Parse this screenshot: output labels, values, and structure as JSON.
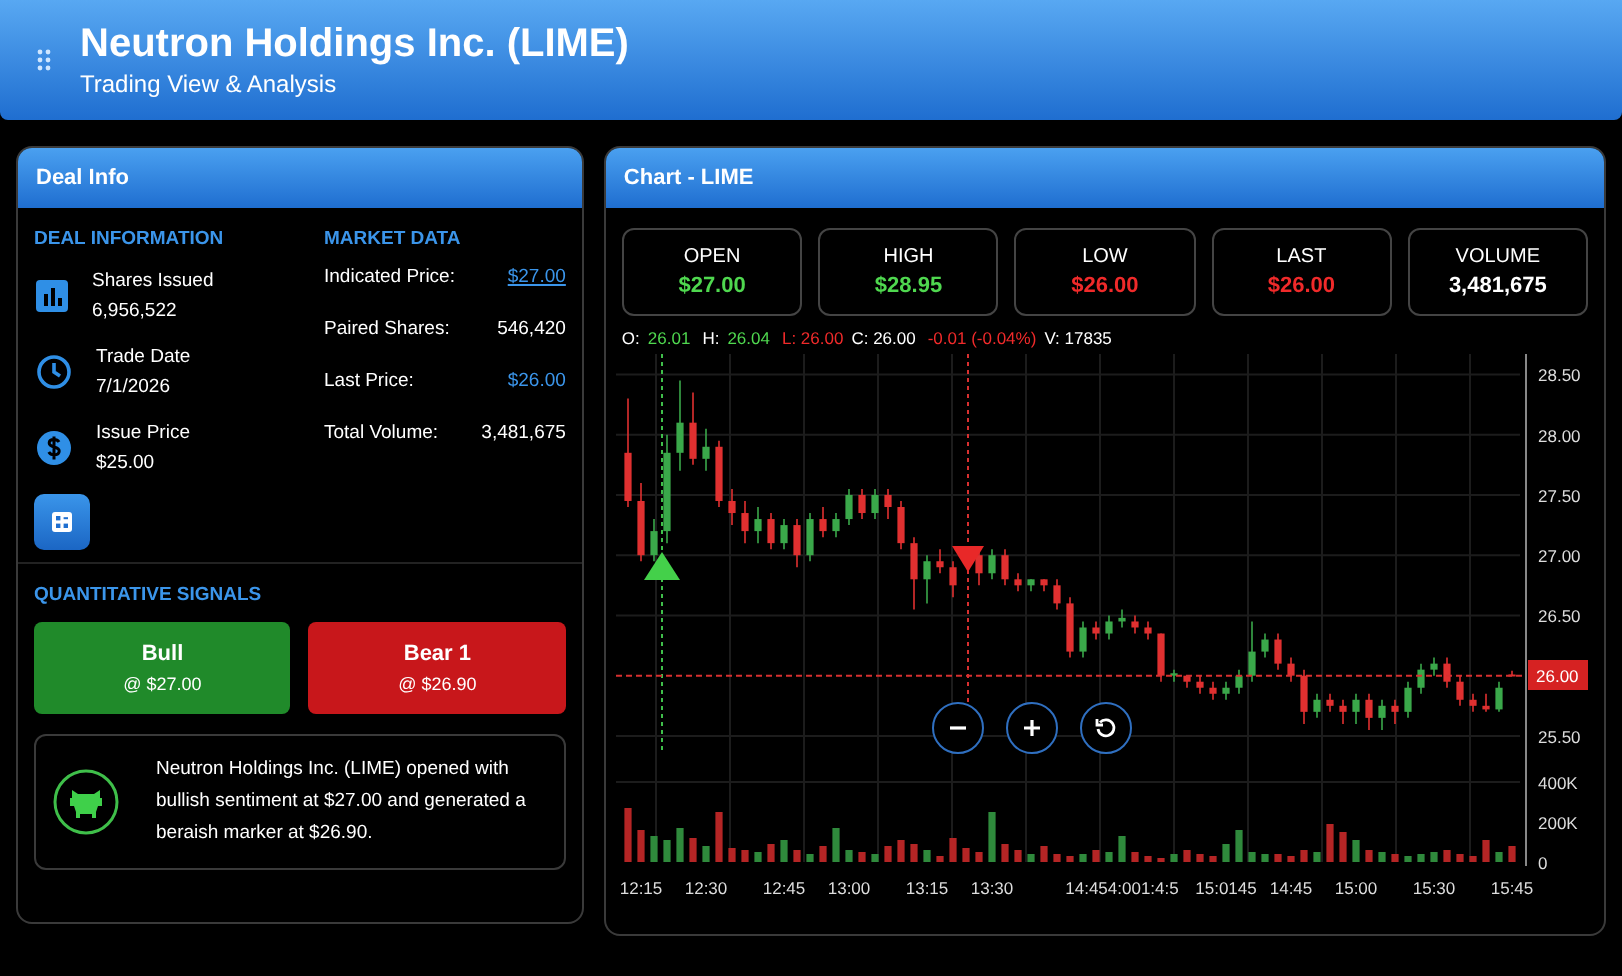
{
  "header": {
    "title": "Neutron Holdings Inc. (LIME)",
    "subtitle": "Trading View & Analysis"
  },
  "deal_panel": {
    "title": "Deal Info",
    "deal_heading": "DEAL INFORMATION",
    "deal_items": [
      {
        "kind": "chart",
        "label": "Shares Issued",
        "value": "6,956,522"
      },
      {
        "kind": "clock",
        "label": "Trade Date",
        "value": "7/1/2026"
      },
      {
        "kind": "dollar",
        "label": "Issue Price",
        "value": "$25.00"
      }
    ],
    "market_heading": "MARKET DATA",
    "market_items": [
      {
        "label": "Indicated Price:",
        "value": "$27.00",
        "kind": "link"
      },
      {
        "label": "Paired Shares:",
        "value": "546,420",
        "kind": "plain"
      },
      {
        "label": "Last Price:",
        "value": "$26.00",
        "kind": "accent"
      },
      {
        "label": "Total Volume:",
        "value": "3,481,675",
        "kind": "plain"
      }
    ],
    "signals_heading": "QUANTITATIVE SIGNALS",
    "signals": [
      {
        "kind": "bull",
        "label": "Bull",
        "price": "@ $27.00"
      },
      {
        "kind": "bear",
        "label": "Bear 1",
        "price": "@ $26.90"
      }
    ],
    "message": "Neutron Holdings Inc. (LIME) opened with bullish sentiment at $27.00 and generated a beraish marker at $26.90."
  },
  "chart_panel": {
    "title": "Chart - LIME",
    "stats": [
      {
        "label": "OPEN",
        "value": "$27.00",
        "kind": "up"
      },
      {
        "label": "HIGH",
        "value": "$28.95",
        "kind": "up"
      },
      {
        "label": "LOW",
        "value": "$26.00",
        "kind": "down"
      },
      {
        "label": "LAST",
        "value": "$26.00",
        "kind": "down"
      },
      {
        "label": "VOLUME",
        "value": "3,481,675",
        "kind": "neutral"
      }
    ],
    "legend": [
      {
        "text": "O:",
        "kind": "neutral"
      },
      {
        "text": "26.01",
        "kind": "up"
      },
      {
        "text": "H:",
        "kind": "neutral"
      },
      {
        "text": "26.04",
        "kind": "up"
      },
      {
        "text": "L: 26.00",
        "kind": "down"
      },
      {
        "text": "C: 26.00",
        "kind": "neutral"
      },
      {
        "text": "-0.01 (-0.04%)",
        "kind": "down"
      },
      {
        "text": "V: 17835",
        "kind": "neutral"
      }
    ],
    "price_chart": {
      "chart_data": {
        "type": "candlestick",
        "grid": true,
        "ohlc": [
          [
            27.85,
            28.3,
            27.4,
            27.45
          ],
          [
            27.45,
            27.6,
            26.95,
            27.0
          ],
          [
            27.0,
            27.3,
            26.95,
            27.2
          ],
          [
            27.2,
            28.0,
            27.1,
            27.85
          ],
          [
            27.85,
            28.45,
            27.7,
            28.1
          ],
          [
            28.1,
            28.35,
            27.75,
            27.8
          ],
          [
            27.8,
            28.05,
            27.7,
            27.9
          ],
          [
            27.9,
            27.95,
            27.4,
            27.45
          ],
          [
            27.45,
            27.55,
            27.25,
            27.35
          ],
          [
            27.35,
            27.45,
            27.1,
            27.2
          ],
          [
            27.2,
            27.4,
            27.1,
            27.3
          ],
          [
            27.3,
            27.35,
            27.05,
            27.1
          ],
          [
            27.1,
            27.3,
            27.05,
            27.25
          ],
          [
            27.25,
            27.3,
            26.9,
            27.0
          ],
          [
            27.0,
            27.35,
            26.95,
            27.3
          ],
          [
            27.3,
            27.4,
            27.15,
            27.2
          ],
          [
            27.2,
            27.35,
            27.15,
            27.3
          ],
          [
            27.3,
            27.55,
            27.25,
            27.5
          ],
          [
            27.5,
            27.55,
            27.3,
            27.35
          ],
          [
            27.35,
            27.55,
            27.3,
            27.5
          ],
          [
            27.5,
            27.55,
            27.3,
            27.4
          ],
          [
            27.4,
            27.45,
            27.05,
            27.1
          ],
          [
            27.1,
            27.15,
            26.55,
            26.8
          ],
          [
            26.8,
            27.0,
            26.6,
            26.95
          ],
          [
            26.95,
            27.05,
            26.85,
            26.9
          ],
          [
            26.9,
            26.95,
            26.65,
            26.75
          ],
          null,
          [
            27.0,
            27.05,
            26.75,
            26.85
          ],
          [
            26.85,
            27.05,
            26.8,
            27.0
          ],
          [
            27.0,
            27.05,
            26.75,
            26.8
          ],
          [
            26.8,
            26.85,
            26.7,
            26.75
          ],
          [
            26.75,
            26.8,
            26.7,
            26.8
          ],
          [
            26.8,
            26.8,
            26.7,
            26.75
          ],
          [
            26.75,
            26.8,
            26.55,
            26.6
          ],
          [
            26.6,
            26.65,
            26.15,
            26.2
          ],
          [
            26.2,
            26.45,
            26.15,
            26.4
          ],
          [
            26.4,
            26.45,
            26.3,
            26.35
          ],
          [
            26.35,
            26.5,
            26.3,
            26.45
          ],
          [
            26.45,
            26.55,
            26.4,
            26.48
          ],
          [
            26.45,
            26.5,
            26.35,
            26.4
          ],
          [
            26.4,
            26.45,
            26.3,
            26.35
          ],
          [
            26.35,
            26.35,
            25.95,
            26.0
          ],
          [
            26.0,
            26.05,
            25.95,
            26.02
          ],
          [
            26.0,
            26.0,
            25.9,
            25.95
          ],
          [
            25.95,
            26.0,
            25.85,
            25.9
          ],
          [
            25.9,
            25.95,
            25.8,
            25.85
          ],
          [
            25.85,
            25.95,
            25.8,
            25.9
          ],
          [
            25.9,
            26.05,
            25.85,
            26.0
          ],
          [
            26.0,
            26.45,
            25.95,
            26.2
          ],
          [
            26.2,
            26.35,
            26.15,
            26.3
          ],
          [
            26.3,
            26.35,
            26.05,
            26.1
          ],
          [
            26.1,
            26.15,
            25.95,
            26.0
          ],
          [
            26.0,
            26.05,
            25.6,
            25.7
          ],
          [
            25.7,
            25.85,
            25.65,
            25.8
          ],
          [
            25.8,
            25.85,
            25.7,
            25.75
          ],
          [
            25.75,
            25.8,
            25.6,
            25.7
          ],
          [
            25.7,
            25.85,
            25.6,
            25.8
          ],
          [
            25.8,
            25.85,
            25.55,
            25.65
          ],
          [
            25.65,
            25.8,
            25.55,
            25.75
          ],
          [
            25.75,
            25.8,
            25.6,
            25.7
          ],
          [
            25.7,
            25.95,
            25.65,
            25.9
          ],
          [
            25.9,
            26.1,
            25.85,
            26.05
          ],
          [
            26.05,
            26.15,
            26.0,
            26.1
          ],
          [
            26.1,
            26.15,
            25.9,
            25.95
          ],
          [
            25.95,
            26.0,
            25.75,
            25.8
          ],
          [
            25.8,
            25.85,
            25.7,
            25.75
          ],
          [
            25.75,
            25.85,
            25.7,
            25.72
          ],
          [
            25.72,
            25.95,
            25.7,
            25.9
          ],
          [
            26.01,
            26.04,
            26.0,
            26.0
          ]
        ],
        "ylim": [
          25.35,
          28.67
        ],
        "yticks": [
          {
            "value": 28.5,
            "label": "28.50"
          },
          {
            "value": 28,
            "label": "28.00"
          },
          {
            "value": 27.5,
            "label": "27.50"
          },
          {
            "value": 27,
            "label": "27.00"
          },
          {
            "value": 26.5,
            "label": "26.50"
          },
          {
            "value": 25.5,
            "label": "25.50"
          }
        ],
        "ref_lines": [
          {
            "axis": "y",
            "value": 26
          }
        ]
      }
    },
    "last_price_tag": "26.00",
    "volume_chart": {
      "chart_data": {
        "type": "bar",
        "grid": true,
        "categories": [
          null,
          "12:15",
          null,
          null,
          null,
          null,
          "12:30",
          null,
          null,
          null,
          null,
          null,
          "12:45",
          null,
          null,
          null,
          null,
          "13:00",
          null,
          null,
          null,
          null,
          null,
          "13:15",
          null,
          null,
          null,
          null,
          "13:30",
          null,
          null,
          null,
          null,
          null,
          null,
          null,
          null,
          null,
          "14:454:001:4:5",
          null,
          null,
          null,
          null,
          null,
          null,
          null,
          "15:0145",
          null,
          null,
          null,
          null,
          "14:45",
          null,
          null,
          null,
          null,
          "15:00",
          null,
          null,
          null,
          null,
          null,
          "15:30",
          null,
          null,
          null,
          null,
          null,
          "15:45"
        ],
        "values": [
          270,
          160,
          130,
          110,
          170,
          120,
          80,
          250,
          70,
          60,
          50,
          90,
          110,
          60,
          40,
          80,
          170,
          60,
          50,
          40,
          80,
          110,
          90,
          60,
          30,
          120,
          70,
          50,
          250,
          90,
          60,
          40,
          80,
          40,
          30,
          40,
          60,
          50,
          130,
          50,
          30,
          20,
          40,
          60,
          40,
          30,
          90,
          160,
          50,
          40,
          40,
          30,
          60,
          50,
          190,
          150,
          110,
          60,
          50,
          40,
          30,
          40,
          50,
          60,
          40,
          30,
          110,
          50,
          80
        ],
        "ylim": [
          0,
          540
        ],
        "yticks": [
          {
            "value": 400,
            "label": "400K"
          },
          {
            "value": 200,
            "label": "200K"
          },
          {
            "value": 0,
            "label": "0"
          }
        ]
      }
    }
  }
}
